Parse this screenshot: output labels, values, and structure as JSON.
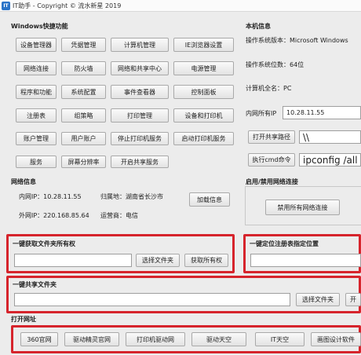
{
  "window": {
    "title": "IT助手 - Copyright © 流水新星 2019",
    "icon_text": "IT"
  },
  "shortcuts": {
    "label": "Windows快捷功能",
    "buttons": [
      "设备管理器",
      "凭据管理",
      "计算机管理",
      "IE浏览器设置",
      "网络连接",
      "防火墙",
      "网络和共享中心",
      "电源管理",
      "程序和功能",
      "系统配置",
      "事件查看器",
      "控制面板",
      "注册表",
      "组策略",
      "打印管理",
      "设备和打印机",
      "账户管理",
      "用户账户",
      "停止打印机服务",
      "启动打印机服务",
      "服务",
      "屏幕分辨率",
      "开启共享服务"
    ]
  },
  "machine": {
    "label": "本机信息",
    "os_version": "操作系统版本：Microsoft Windows",
    "os_bits": "操作系统位数：64位",
    "computer_name": "计算机全名：PC",
    "intranet_label": "内网所有IP",
    "intranet_ip": "10.28.11.55",
    "open_share_button": "打开共享路径",
    "share_path": "\\\\",
    "run_cmd_button": "执行cmd命令",
    "cmd_value": "ipconfig /all"
  },
  "network": {
    "label": "网络信息",
    "intranet": "内网IP：10.28.11.55",
    "location": "归属地：湖南省长沙市",
    "extranet": "外网IP：220.168.85.64",
    "isp": "运营商：电信",
    "load_button": "加载信息"
  },
  "nic": {
    "label": "启用/禁用网络连接",
    "disable_all_button": "禁用所有网络连接"
  },
  "ownership": {
    "label": "一键获取文件夹所有权",
    "path_value": "",
    "choose_button": "选择文件夹",
    "get_button": "获取所有权"
  },
  "registry": {
    "label": "一键定位注册表指定位置",
    "path_value": ""
  },
  "share_folder": {
    "label": "一键共享文件夹",
    "path_value": "",
    "choose_button": "选择文件夹",
    "partial_button": "开"
  },
  "urls": {
    "label": "打开网址",
    "buttons": [
      "360官网",
      "驱动精灵官网",
      "打印机驱动网",
      "驱动天空",
      "IT天空",
      "画图设计软件"
    ]
  }
}
